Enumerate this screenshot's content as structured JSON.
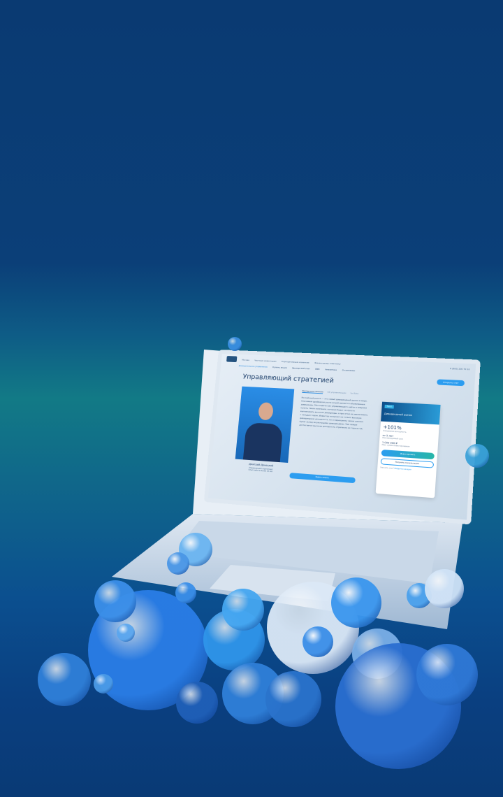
{
  "screen": {
    "nav": {
      "top_links": [
        "Москва",
        "Частным инвесторам",
        "Корпоративным клиентам",
        "Финансовому советнику"
      ],
      "main_links": [
        "Доверительное управление",
        "Купить акции",
        "Брокерский счет",
        "ИИС",
        "Аналитика",
        "О компании"
      ],
      "phone": "8 (800) 200 70 10",
      "cta": "Открыть счет"
    },
    "title": "Управляющий стратегией",
    "manager": {
      "name": "Дмитрий Донецкий",
      "role": "Управляющий стратегией",
      "experience": "Опыт работы более 15 лет"
    },
    "tabs": [
      "Экспертное мнение",
      "Об управляющем",
      "YouTube"
    ],
    "text": "Российский рынок — это самый дивидендный рынок в мире. Ключевым драйвером роста акций являются объявленные дивиденды. Моя задача как управляющего найти и вовремя купить такие компании, которые будут не просто выплачивать высокие дивиденды, а при этом их увеличивать с каждым годом. Инвестор получает не только высокую дивидендную доходность, но и переоценку самих ценных бумаг вслед за растущими дивидендами. Тем самым достигается высокая доходность стратегии из года в год.",
    "ask_button": "Задать вопрос",
    "card": {
      "tag": "Топ-3",
      "title": "Дивидендный рынок",
      "yield": "+101%",
      "yield_label": "Ожидаемая доходность",
      "term": "от 5 лет",
      "term_label": "Рекомендуемый срок",
      "sum": "1 000 000 ₽",
      "sum_label": "Мин. сумма инвестирования",
      "invest": "Инвестировать",
      "consult": "Получить консультацию",
      "footer": "Уже есть счет?",
      "footer_link": "Войдите в аккаунт"
    }
  },
  "colors": {
    "background": "#0a3a72",
    "accent": "#2c9df0",
    "teal": "#127a86"
  }
}
